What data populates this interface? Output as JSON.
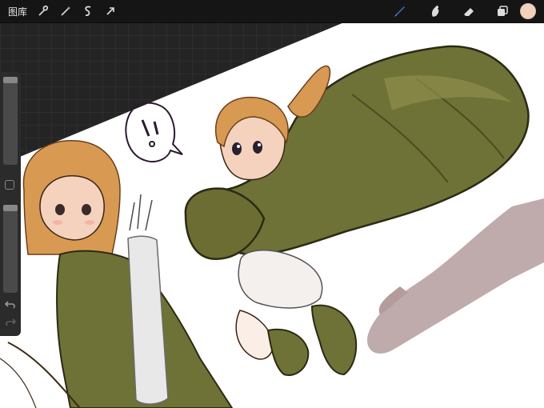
{
  "topbar": {
    "gallery_label": "图库",
    "actions_icon": "wrench-icon",
    "adjustments_icon": "magic-wand-icon",
    "selection_icon": "selection-s-icon",
    "transform_icon": "arrow-cursor-icon"
  },
  "tools": {
    "brush_icon": "brush-icon",
    "brush_active_color": "#3f74c9",
    "smudge_icon": "smudge-finger-icon",
    "eraser_icon": "eraser-icon",
    "layers_icon": "layers-icon",
    "current_color": "#f4d0bb"
  },
  "sidebar": {
    "brush_size_icon": "size-slider",
    "modify_icon": "square-modify-icon",
    "opacity_icon": "opacity-slider",
    "undo_icon": "undo-arrow-icon",
    "redo_icon": "redo-arrow-icon"
  },
  "colors": {
    "toolbar_bg": "#151515",
    "workspace_bg": "#242424",
    "paper": "#ffffff",
    "cape_green": "#6f7236",
    "hair_orange": "#d89a52",
    "skin": "#f4d2bd",
    "shadow_mauve": "#a88e8e"
  }
}
